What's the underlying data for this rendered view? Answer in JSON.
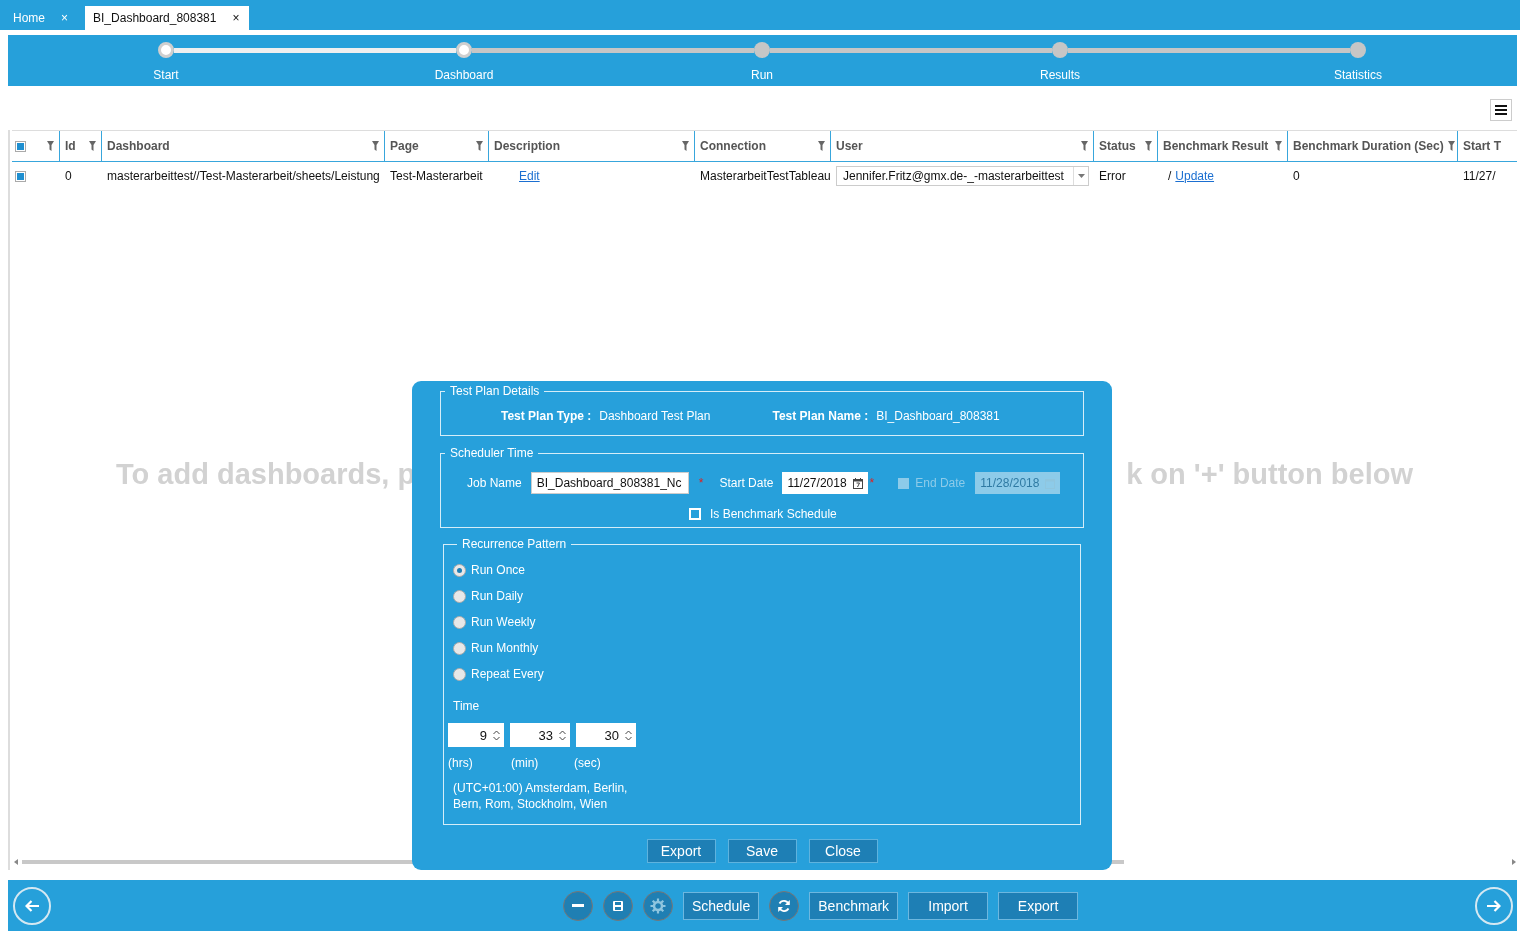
{
  "tabs": [
    {
      "label": "Home",
      "selected": false,
      "close": "×"
    },
    {
      "label": "BI_Dashboard_808381",
      "selected": true,
      "close": "×"
    }
  ],
  "stepper": {
    "steps": [
      {
        "label": "Start",
        "done": true
      },
      {
        "label": "Dashboard",
        "done": true
      },
      {
        "label": "Run",
        "done": false
      },
      {
        "label": "Results",
        "done": false
      },
      {
        "label": "Statistics",
        "done": false
      }
    ]
  },
  "grid": {
    "select_all": {
      "checked": true
    },
    "columns": [
      {
        "label": "Id",
        "filter": true
      },
      {
        "label": "Dashboard",
        "filter": true
      },
      {
        "label": "Page",
        "filter": true
      },
      {
        "label": "Description",
        "filter": true
      },
      {
        "label": "Connection",
        "filter": true
      },
      {
        "label": "User",
        "filter": true
      },
      {
        "label": "Status",
        "filter": true
      },
      {
        "label": "Benchmark Result",
        "filter": true
      },
      {
        "label": "Benchmark Duration (Sec)",
        "filter": true
      },
      {
        "label": "Start T",
        "filter": false
      }
    ],
    "rows": [
      {
        "selected": true,
        "cells": [
          {
            "kind": "text",
            "text": "0"
          },
          {
            "kind": "text",
            "text": "masterarbeittest//Test-Masterarbeit/sheets/Leistung"
          },
          {
            "kind": "text",
            "text": "Test-Masterarbeit"
          },
          {
            "kind": "link",
            "text": "Edit"
          },
          {
            "kind": "text",
            "text": "MasterarbeitTestTableau"
          },
          {
            "kind": "dropdown",
            "text": "Jennifer.Fritz@gmx.de-_-masterarbeittest"
          },
          {
            "kind": "text",
            "text": "Error"
          },
          {
            "kind": "link",
            "prefix": "/",
            "text": "Update"
          },
          {
            "kind": "text",
            "text": "0"
          },
          {
            "kind": "text",
            "text": "11/27/"
          }
        ]
      }
    ],
    "empty_hint": {
      "left": "To add dashboards, p",
      "right": "k on '+' button below"
    }
  },
  "dialog": {
    "details": {
      "title": "Test Plan Details",
      "type_label": "Test Plan Type :",
      "type_value": "Dashboard Test Plan",
      "name_label": "Test Plan Name :",
      "name_value": "BI_Dashboard_808381"
    },
    "scheduler": {
      "title": "Scheduler Time",
      "job_label": "Job Name",
      "job_value": "BI_Dashboard_808381_Nc",
      "required": "*",
      "start_label": "Start Date",
      "start_value": "11/27/2018",
      "end_checked": false,
      "end_disabled": true,
      "end_label": "End Date",
      "end_value": "11/28/2018",
      "benchmark_label": "Is Benchmark Schedule",
      "benchmark_checked": false
    },
    "recurrence": {
      "title": "Recurrence Pattern",
      "options": [
        {
          "label": "Run Once",
          "selected": true
        },
        {
          "label": "Run Daily",
          "selected": false
        },
        {
          "label": "Run Weekly",
          "selected": false
        },
        {
          "label": "Run Monthly",
          "selected": false
        },
        {
          "label": "Repeat Every",
          "selected": false
        }
      ],
      "time_label": "Time",
      "time": [
        {
          "value": "9",
          "unit": "(hrs)"
        },
        {
          "value": "33",
          "unit": "(min)"
        },
        {
          "value": "30",
          "unit": "(sec)"
        }
      ],
      "timezone": "(UTC+01:00) Amsterdam, Berlin, Bern, Rom, Stockholm, Wien"
    },
    "buttons": [
      "Export",
      "Save",
      "Close"
    ]
  },
  "toolbar": {
    "items": [
      {
        "kind": "back"
      },
      {
        "kind": "minus"
      },
      {
        "kind": "save"
      },
      {
        "kind": "gear"
      },
      {
        "kind": "text",
        "label": "Schedule"
      },
      {
        "kind": "refresh"
      },
      {
        "kind": "text",
        "label": "Benchmark"
      },
      {
        "kind": "text",
        "label": "Import"
      },
      {
        "kind": "text",
        "label": "Export"
      },
      {
        "kind": "next"
      }
    ]
  }
}
